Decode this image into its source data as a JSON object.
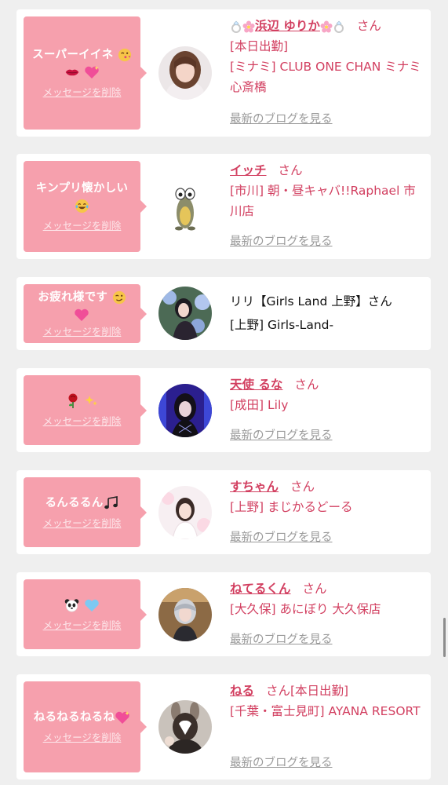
{
  "delete_label": "メッセージを削除",
  "blog_label": "最新のブログを見る",
  "san": "さん",
  "cards": [
    {
      "message": "スーパーイイネ",
      "message_icons": [
        "wink-kiss-emoji",
        "lips-emoji",
        "sparkling-heart-emoji"
      ],
      "name": "浜辺 ゆりか",
      "name_icons": [
        "ring-emoji",
        "cherry-blossom-emoji"
      ],
      "status": "[本日出勤]",
      "shop": "[ミナミ] CLUB ONE CHAN ミナミ 心斎橋"
    },
    {
      "message": "キンプリ懐かしい",
      "message_icons": [
        "tears-of-joy-emoji"
      ],
      "name": "イッチ",
      "shop": "[市川] 朝・昼キャバ!!Raphael 市川店"
    },
    {
      "message": "お疲れ様です",
      "message_icons": [
        "wink-emoji",
        "pink-heart-emoji"
      ],
      "name": "リリ【Girls Land 上野】",
      "shop": "[上野] Girls-Land-"
    },
    {
      "message": "",
      "message_icons": [
        "rose-emoji",
        "sparkles-emoji"
      ],
      "name": "天使 るな",
      "shop": "[成田] Lily"
    },
    {
      "message": "るんるるん",
      "message_icons": [
        "music-notes-emoji"
      ],
      "name": "すちゃん",
      "shop": "[上野] まじかるどーる"
    },
    {
      "message": "",
      "message_icons": [
        "panda-emoji",
        "light-blue-heart-emoji"
      ],
      "name": "ねてるくん",
      "shop": "[大久保] あにぼり 大久保店"
    },
    {
      "message": "ねるねるねるね",
      "message_icons": [
        "sparkling-heart-emoji"
      ],
      "name": "ねる",
      "status": "[本日出勤]",
      "shop": "[千葉・富士見町] AYANA RESORT"
    }
  ],
  "colors": {
    "bubble": "#f6a0ad",
    "accent": "#d23f60",
    "link_gray": "#9a9a9a",
    "background": "#efefef"
  }
}
